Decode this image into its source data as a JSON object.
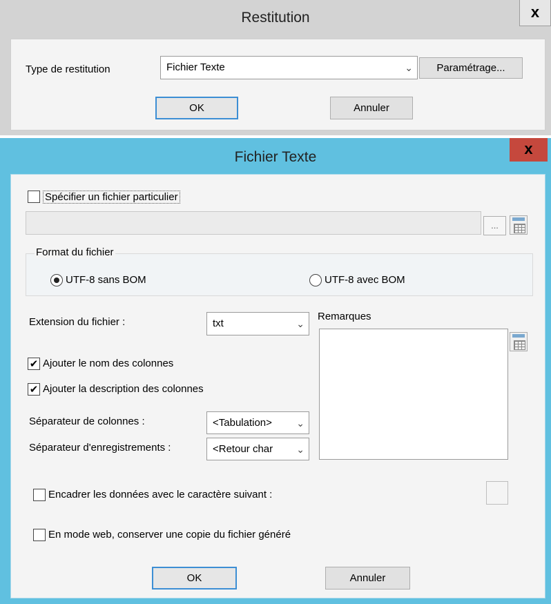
{
  "restitution": {
    "title": "Restitution",
    "close_glyph": "x",
    "type_label": "Type de restitution",
    "type_value": "Fichier Texte",
    "parametrage_label": "Paramétrage...",
    "ok_label": "OK",
    "cancel_label": "Annuler"
  },
  "fichier_texte": {
    "title": "Fichier Texte",
    "close_glyph": "x",
    "specific_file_label": "Spécifier un fichier particulier",
    "specific_file_checked": false,
    "file_path_value": "",
    "browse_label": "...",
    "format_group_label": "Format du fichier",
    "format_options": [
      {
        "label": "UTF-8 sans BOM",
        "selected": true
      },
      {
        "label": "UTF-8 avec BOM",
        "selected": false
      }
    ],
    "extension_label": "Extension du fichier :",
    "extension_value": "txt",
    "remarks_label": "Remarques",
    "remarks_value": "",
    "add_column_names_label": "Ajouter le nom des colonnes",
    "add_column_names_checked": true,
    "add_column_desc_label": "Ajouter la description des colonnes",
    "add_column_desc_checked": true,
    "col_separator_label": "Séparateur de colonnes :",
    "col_separator_value": "<Tabulation>",
    "rec_separator_label": "Séparateur d'enregistrements :",
    "rec_separator_value": "<Retour char",
    "frame_data_label": "Encadrer les données avec le caractère suivant :",
    "frame_data_checked": false,
    "frame_char_value": "",
    "web_copy_label": "En mode web, conserver une copie du fichier généré",
    "web_copy_checked": false,
    "ok_label": "OK",
    "cancel_label": "Annuler"
  },
  "icons": {
    "checkmark": "✔",
    "chevron": "⌄"
  },
  "colors": {
    "active_titlebar": "#60c0e0",
    "close_button": "#c5483d",
    "inactive_titlebar": "#d3d3d3",
    "default_button_border": "#3c8ed4"
  }
}
